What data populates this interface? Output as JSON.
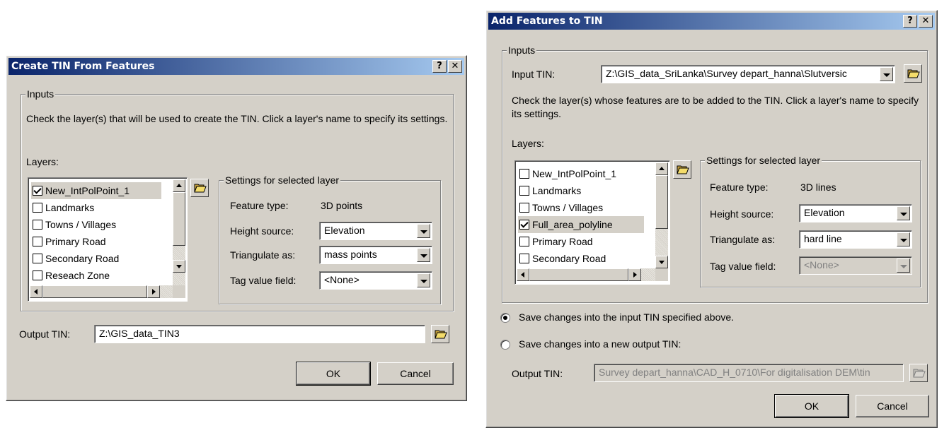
{
  "create_dialog": {
    "title": "Create TIN From Features",
    "help_button": "?",
    "close_button": "✕",
    "inputs_legend": "Inputs",
    "instructions": "Check the layer(s) that will be used to create the TIN.  Click a layer's name to specify its settings.",
    "layers_label": "Layers:",
    "layers": [
      {
        "name": "New_IntPolPoint_1",
        "checked": true
      },
      {
        "name": "Landmarks",
        "checked": false
      },
      {
        "name": "Towns / Villages",
        "checked": false
      },
      {
        "name": "Primary Road",
        "checked": false
      },
      {
        "name": "Secondary Road",
        "checked": false
      },
      {
        "name": "Reseach Zone",
        "checked": false
      }
    ],
    "settings_legend": "Settings for selected layer",
    "feature_type_label": "Feature type:",
    "feature_type_value": "3D points",
    "height_source_label": "Height source:",
    "height_source_value": "Elevation",
    "triangulate_label": "Triangulate as:",
    "triangulate_value": "mass points",
    "tag_label": "Tag value field:",
    "tag_value": "<None>",
    "output_label": "Output TIN:",
    "output_value": "Z:\\GIS_data_TIN3",
    "ok": "OK",
    "cancel": "Cancel"
  },
  "add_dialog": {
    "title": "Add Features to TIN",
    "help_button": "?",
    "close_button": "✕",
    "inputs_legend": "Inputs",
    "input_tin_label": "Input TIN:",
    "input_tin_value": "Z:\\GIS_data_SriLanka\\Survey depart_hanna\\Slutversic",
    "instructions": "Check the layer(s) whose features are to be added to the TIN.  Click a layer's name to specify its settings.",
    "layers_label": "Layers:",
    "layers": [
      {
        "name": "New_IntPolPoint_1",
        "checked": false
      },
      {
        "name": "Landmarks",
        "checked": false
      },
      {
        "name": "Towns / Villages",
        "checked": false
      },
      {
        "name": "Full_area_polyline",
        "checked": true
      },
      {
        "name": "Primary Road",
        "checked": false
      },
      {
        "name": "Secondary Road",
        "checked": false
      }
    ],
    "settings_legend": "Settings for selected layer",
    "feature_type_label": "Feature type:",
    "feature_type_value": "3D lines",
    "height_source_label": "Height source:",
    "height_source_value": "Elevation",
    "triangulate_label": "Triangulate as:",
    "triangulate_value": "hard line",
    "tag_label": "Tag value field:",
    "tag_value": "<None>",
    "radio_save_input": "Save changes into the input TIN specified above.",
    "radio_save_new": "Save changes into a new output TIN:",
    "output_label": "Output TIN:",
    "output_value": "Survey depart_hanna\\CAD_H_0710\\For digitalisation DEM\\tin",
    "ok": "OK",
    "cancel": "Cancel"
  },
  "colors": {
    "title_start": "#0a246a",
    "title_end": "#a6caf0",
    "face": "#d4d0c8"
  },
  "icons": {
    "browse": "open-folder-icon"
  }
}
